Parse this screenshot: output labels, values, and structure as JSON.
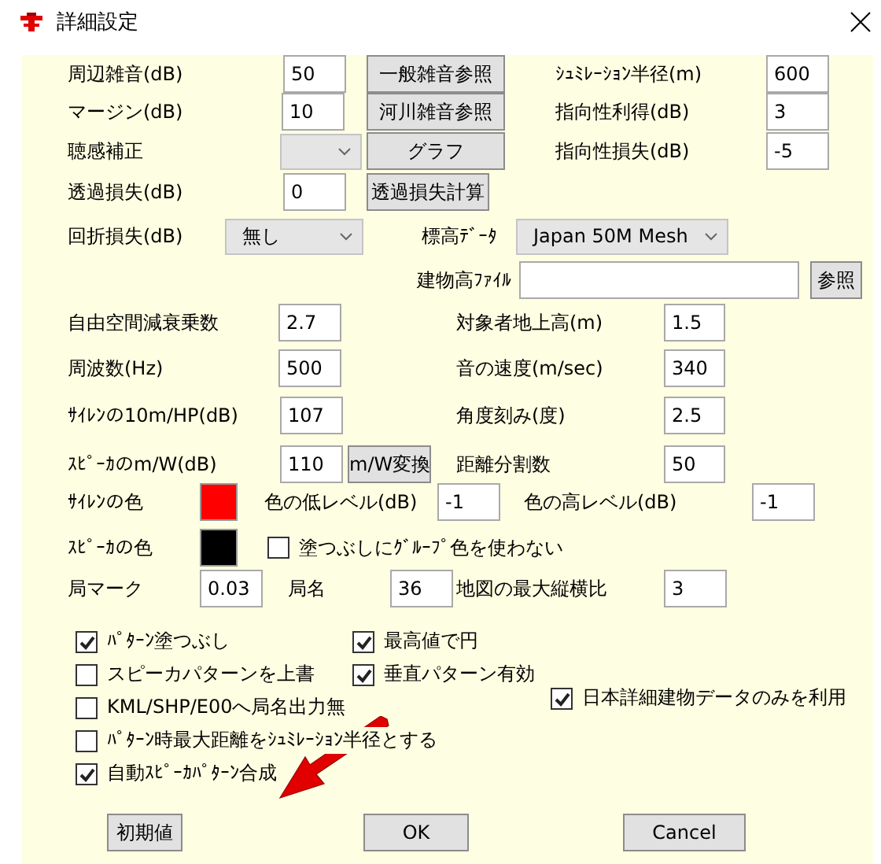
{
  "window": {
    "title": "詳細設定"
  },
  "rows": [
    [
      {
        "kind": "label",
        "text": "周辺雑音(dB)"
      },
      {
        "kind": "input",
        "value": "50"
      },
      {
        "kind": "button",
        "label": "一般雑音参照"
      },
      {
        "kind": "label",
        "text": "ｼｭﾐﾚｰｼｮﾝ半径(m)"
      },
      {
        "kind": "input",
        "value": "600"
      }
    ],
    [
      {
        "kind": "label",
        "text": "マージン(dB)"
      },
      {
        "kind": "input",
        "value": "10"
      },
      {
        "kind": "button",
        "label": "河川雑音参照"
      },
      {
        "kind": "label",
        "text": "指向性利得(dB)"
      },
      {
        "kind": "input",
        "value": "3"
      }
    ],
    [
      {
        "kind": "label",
        "text": "聴感補正"
      },
      {
        "kind": "select"
      },
      {
        "kind": "button",
        "label": "グラフ"
      },
      {
        "kind": "label",
        "text": "指向性損失(dB)"
      },
      {
        "kind": "input",
        "value": "-5"
      }
    ],
    [
      {
        "kind": "label",
        "text": "透過損失(dB)"
      },
      {
        "kind": "input",
        "value": "0"
      },
      {
        "kind": "button",
        "label": "透過損失計算"
      }
    ],
    [
      {
        "kind": "label",
        "text": "回折損失(dB)"
      },
      {
        "kind": "select",
        "value": "無し"
      },
      {
        "kind": "label",
        "text": "標高ﾃﾞｰﾀ"
      },
      {
        "kind": "select",
        "value": "Japan 50M Mesh"
      }
    ],
    [
      {
        "kind": "label",
        "text": "建物高ﾌｧｲﾙ"
      },
      {
        "kind": "input"
      },
      {
        "kind": "button",
        "label": "参照"
      }
    ],
    [
      {
        "kind": "label",
        "text": "自由空間減衰乗数"
      },
      {
        "kind": "input",
        "value": "2.7"
      },
      {
        "kind": "label",
        "text": "対象者地上高(m)"
      },
      {
        "kind": "input",
        "value": "1.5"
      }
    ],
    [
      {
        "kind": "label",
        "text": "周波数(Hz)"
      },
      {
        "kind": "input",
        "value": "500"
      },
      {
        "kind": "label",
        "text": "音の速度(m/sec)"
      },
      {
        "kind": "input",
        "value": "340"
      }
    ],
    [
      {
        "kind": "label",
        "text": "ｻｲﾚﾝの10m/HP(dB)"
      },
      {
        "kind": "input",
        "value": "107"
      },
      {
        "kind": "label",
        "text": "角度刻み(度)"
      },
      {
        "kind": "input",
        "value": "2.5"
      }
    ],
    [
      {
        "kind": "label",
        "text": "ｽﾋﾟｰｶのm/W(dB)"
      },
      {
        "kind": "input",
        "value": "110"
      },
      {
        "kind": "button",
        "label": "m/W変換"
      },
      {
        "kind": "label",
        "text": "距離分割数"
      },
      {
        "kind": "input",
        "value": "50"
      }
    ],
    [
      {
        "kind": "label",
        "text": "ｻｲﾚﾝの色"
      },
      {
        "kind": "swatch",
        "color": "#ff0000"
      },
      {
        "kind": "label",
        "text": "色の低レベル(dB)"
      },
      {
        "kind": "input",
        "value": "-1"
      },
      {
        "kind": "label",
        "text": "色の高レベル(dB)"
      },
      {
        "kind": "input",
        "value": "-1"
      }
    ],
    [
      {
        "kind": "label",
        "text": "ｽﾋﾟｰｶの色"
      },
      {
        "kind": "swatch",
        "color": "#000000"
      },
      {
        "kind": "checkbox",
        "label": "塗つぶしにｸﾞﾙｰﾌﾟ色を使わない",
        "checked": false
      }
    ],
    [
      {
        "kind": "label",
        "text": "局マーク"
      },
      {
        "kind": "input",
        "value": "0.03"
      },
      {
        "kind": "label",
        "text": "局名"
      },
      {
        "kind": "input",
        "value": "36"
      },
      {
        "kind": "label",
        "text": "地図の最大縦横比"
      },
      {
        "kind": "input",
        "value": "3"
      }
    ]
  ],
  "checkboxes_left": [
    {
      "label": "ﾊﾟﾀｰﾝ塗つぶし",
      "checked": true
    },
    {
      "label": "スピーカパターンを上書",
      "checked": false
    },
    {
      "label": "KML/SHP/E00へ局名出力無",
      "checked": false
    },
    {
      "label": "ﾊﾟﾀｰﾝ時最大距離をｼｭﾐﾚｰｼｮﾝ半径とする",
      "checked": false
    },
    {
      "label": "自動ｽﾋﾟｰｶﾊﾟﾀｰﾝ合成",
      "checked": true
    }
  ],
  "checkboxes_middle": [
    {
      "label": "最高値で円",
      "checked": true
    },
    {
      "label": "垂直パターン有効",
      "checked": true
    }
  ],
  "checkboxes_right": [
    {
      "label": "日本詳細建物データのみを利用",
      "checked": true
    }
  ],
  "buttons": [
    "初期値",
    "OK",
    "Cancel"
  ]
}
